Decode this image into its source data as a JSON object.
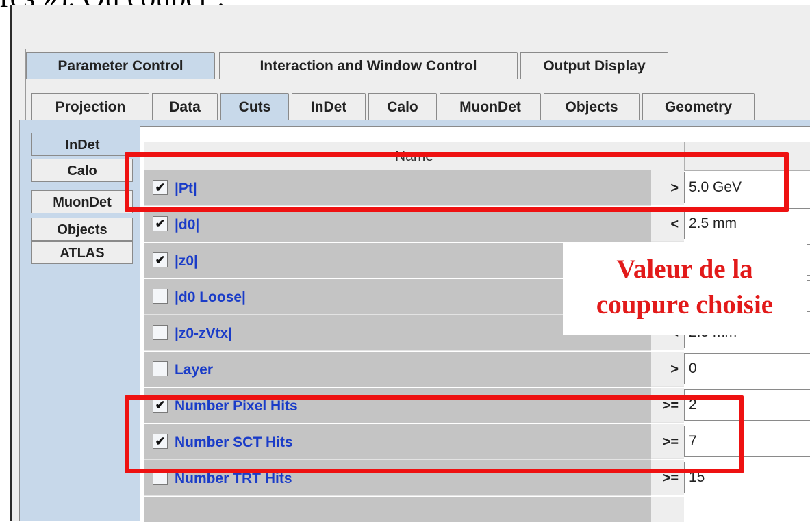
{
  "slide": {
    "top_text": "res »). Ou couper :"
  },
  "tabs_top": [
    {
      "label": "Parameter Control",
      "selected": true
    },
    {
      "label": "Interaction and Window Control",
      "selected": false
    },
    {
      "label": "Output Display",
      "selected": false
    }
  ],
  "tabs_sub": [
    {
      "label": "Projection",
      "selected": false
    },
    {
      "label": "Data",
      "selected": false
    },
    {
      "label": "Cuts",
      "selected": true
    },
    {
      "label": "InDet",
      "selected": false
    },
    {
      "label": "Calo",
      "selected": false
    },
    {
      "label": "MuonDet",
      "selected": false
    },
    {
      "label": "Objects",
      "selected": false
    },
    {
      "label": "Geometry",
      "selected": false
    }
  ],
  "side_tabs": [
    {
      "label": "InDet",
      "selected": true
    },
    {
      "label": "Calo",
      "selected": false
    },
    {
      "label": "MuonDet",
      "selected": false
    },
    {
      "label": "Objects",
      "selected": false
    },
    {
      "label": "ATLAS",
      "selected": false
    }
  ],
  "table": {
    "header_name": "Name",
    "rows": [
      {
        "checked": true,
        "check_mark": "✔",
        "name": "|Pt|",
        "op": ">",
        "value": "5.0 GeV"
      },
      {
        "checked": true,
        "check_mark": "✔",
        "name": "|d0|",
        "op": "<",
        "value": "2.5 mm"
      },
      {
        "checked": true,
        "check_mark": "✔",
        "name": "|z0|",
        "op": "",
        "value": ""
      },
      {
        "checked": false,
        "check_mark": "",
        "name": "|d0 Loose|",
        "op": "",
        "value": ""
      },
      {
        "checked": false,
        "check_mark": "",
        "name": "|z0-zVtx|",
        "op": "<",
        "value": "2.5 mm"
      },
      {
        "checked": false,
        "check_mark": "",
        "name": "Layer",
        "op": ">",
        "value": "0"
      },
      {
        "checked": true,
        "check_mark": "✔",
        "name": "Number Pixel Hits",
        "op": ">=",
        "value": "2"
      },
      {
        "checked": true,
        "check_mark": "✔",
        "name": "Number SCT Hits",
        "op": ">=",
        "value": "7"
      },
      {
        "checked": false,
        "check_mark": "",
        "name": "Number TRT Hits",
        "op": ">=",
        "value": "15"
      }
    ]
  },
  "annotation": {
    "line1": "Valeur de la",
    "line2": "coupure choisie"
  },
  "colors": {
    "highlight": "#ee1111",
    "selected_tab": "#c8d9ea",
    "row_label": "#1a3cc8"
  }
}
